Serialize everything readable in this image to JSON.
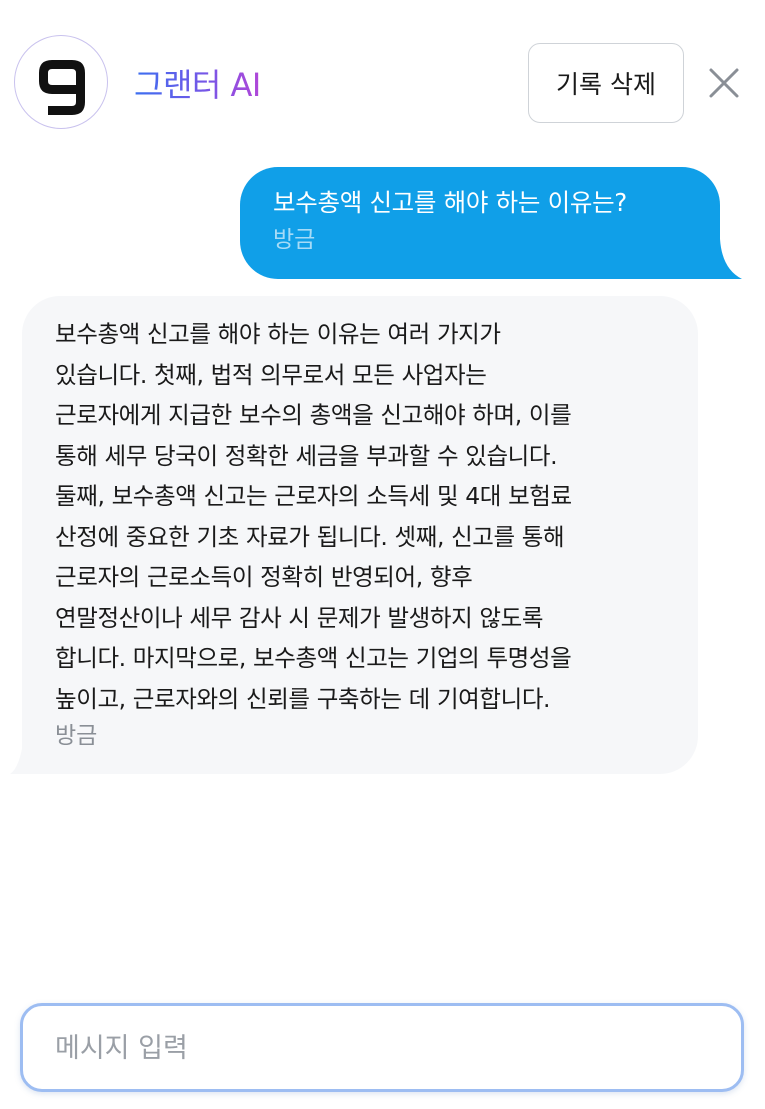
{
  "header": {
    "brand": "그랜터 AI",
    "clear_label": "기록 삭제"
  },
  "messages": [
    {
      "role": "user",
      "text": "보수총액 신고를 해야 하는 이유는?",
      "time": "방금"
    },
    {
      "role": "assistant",
      "text": "보수총액 신고를 해야 하는 이유는 여러 가지가\n있습니다. 첫째, 법적 의무로서 모든 사업자는\n근로자에게 지급한 보수의 총액을 신고해야 하며, 이를\n통해 세무 당국이 정확한 세금을 부과할 수 있습니다.\n둘째, 보수총액 신고는 근로자의 소득세 및 4대 보험료\n산정에 중요한 기초 자료가 됩니다. 셋째, 신고를 통해\n근로자의 근로소득이 정확히 반영되어, 향후\n연말정산이나 세무 감사 시 문제가 발생하지 않도록\n합니다. 마지막으로, 보수총액 신고는 기업의 투명성을\n높이고, 근로자와의 신뢰를 구축하는 데 기여합니다.",
      "time": "방금"
    }
  ],
  "input": {
    "placeholder": "메시지 입력",
    "value": ""
  },
  "colors": {
    "user_bubble": "#109fe8",
    "bot_bubble": "#f6f7f9",
    "input_border": "#9dbdf2"
  }
}
